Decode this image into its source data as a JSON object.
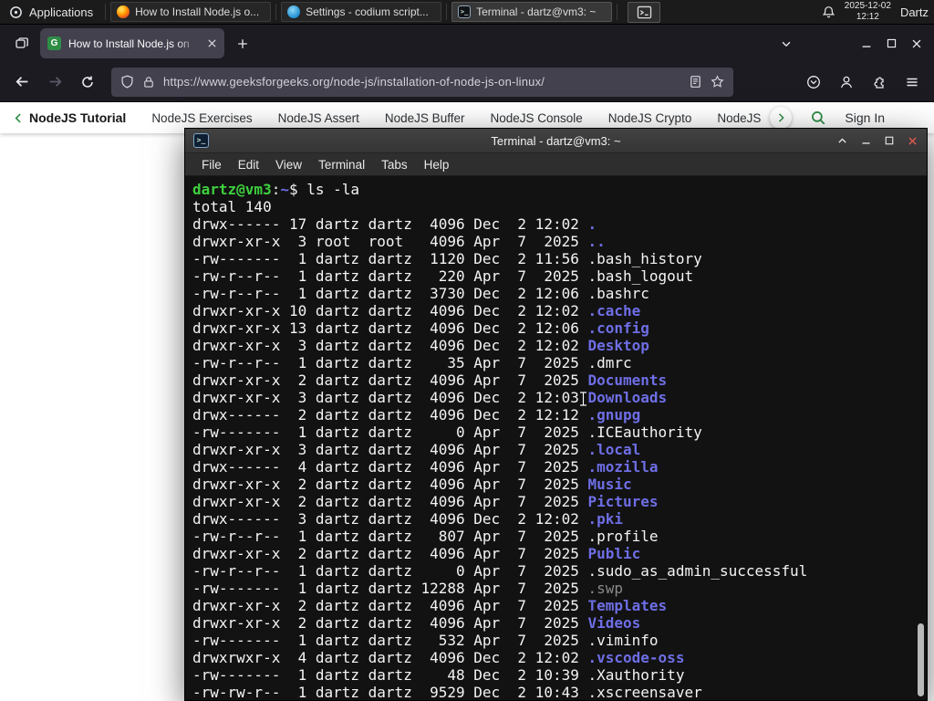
{
  "colors": {
    "accent_green": "#2f8d46",
    "terminal_dir": "#6e6ee6",
    "terminal_green": "#3ecf3e",
    "terminal_dim": "#8a8a8a"
  },
  "taskbar": {
    "applications_label": "Applications",
    "windows": [
      {
        "title": "How to Install Node.js o...",
        "icon": "firefox",
        "active": false
      },
      {
        "title": "Settings - codium script...",
        "icon": "codium",
        "active": false
      },
      {
        "title": "Terminal - dartz@vm3: ~",
        "icon": "terminal",
        "active": true
      }
    ],
    "clock_date": "2025-12-02",
    "clock_time": "12:12",
    "user_label": "Dartz"
  },
  "browser": {
    "tab_title": "How to Install Node.js on",
    "favicon_letter": "G",
    "url": "https://www.geeksforgeeks.org/node-js/installation-of-node-js-on-linux/"
  },
  "site_nav": {
    "back_item": "NodeJS Tutorial",
    "items": [
      "NodeJS Exercises",
      "NodeJS Assert",
      "NodeJS Buffer",
      "NodeJS Console",
      "NodeJS Crypto",
      "NodeJS DNS",
      "Node"
    ],
    "sign_in_label": "Sign In"
  },
  "terminal": {
    "window_title": "Terminal - dartz@vm3: ~",
    "menus": [
      "File",
      "Edit",
      "View",
      "Terminal",
      "Tabs",
      "Help"
    ],
    "prompt_user_host": "dartz@vm3",
    "prompt_colon": ":",
    "prompt_path": "~",
    "prompt_symbol": "$ ",
    "command": "ls -la",
    "total_line": "total 140",
    "listing": [
      {
        "pre": "drwx------ 17 dartz dartz  4096 Dec  2 12:02 ",
        "name": ".",
        "type": "dir"
      },
      {
        "pre": "drwxr-xr-x  3 root  root   4096 Apr  7  2025 ",
        "name": "..",
        "type": "dir"
      },
      {
        "pre": "-rw-------  1 dartz dartz  1120 Dec  2 11:56 ",
        "name": ".bash_history",
        "type": "file"
      },
      {
        "pre": "-rw-r--r--  1 dartz dartz   220 Apr  7  2025 ",
        "name": ".bash_logout",
        "type": "file"
      },
      {
        "pre": "-rw-r--r--  1 dartz dartz  3730 Dec  2 12:06 ",
        "name": ".bashrc",
        "type": "file"
      },
      {
        "pre": "drwxr-xr-x 10 dartz dartz  4096 Dec  2 12:02 ",
        "name": ".cache",
        "type": "dir"
      },
      {
        "pre": "drwxr-xr-x 13 dartz dartz  4096 Dec  2 12:06 ",
        "name": ".config",
        "type": "dir"
      },
      {
        "pre": "drwxr-xr-x  3 dartz dartz  4096 Dec  2 12:02 ",
        "name": "Desktop",
        "type": "dir"
      },
      {
        "pre": "-rw-r--r--  1 dartz dartz    35 Apr  7  2025 ",
        "name": ".dmrc",
        "type": "file"
      },
      {
        "pre": "drwxr-xr-x  2 dartz dartz  4096 Apr  7  2025 ",
        "name": "Documents",
        "type": "dir"
      },
      {
        "pre": "drwxr-xr-x  3 dartz dartz  4096 Dec  2 12:03 ",
        "name": "Downloads",
        "type": "dir"
      },
      {
        "pre": "drwx------  2 dartz dartz  4096 Dec  2 12:12 ",
        "name": ".gnupg",
        "type": "dir"
      },
      {
        "pre": "-rw-------  1 dartz dartz     0 Apr  7  2025 ",
        "name": ".ICEauthority",
        "type": "file"
      },
      {
        "pre": "drwxr-xr-x  3 dartz dartz  4096 Apr  7  2025 ",
        "name": ".local",
        "type": "dir"
      },
      {
        "pre": "drwx------  4 dartz dartz  4096 Apr  7  2025 ",
        "name": ".mozilla",
        "type": "dir"
      },
      {
        "pre": "drwxr-xr-x  2 dartz dartz  4096 Apr  7  2025 ",
        "name": "Music",
        "type": "dir"
      },
      {
        "pre": "drwxr-xr-x  2 dartz dartz  4096 Apr  7  2025 ",
        "name": "Pictures",
        "type": "dir"
      },
      {
        "pre": "drwx------  3 dartz dartz  4096 Dec  2 12:02 ",
        "name": ".pki",
        "type": "dir"
      },
      {
        "pre": "-rw-r--r--  1 dartz dartz   807 Apr  7  2025 ",
        "name": ".profile",
        "type": "file"
      },
      {
        "pre": "drwxr-xr-x  2 dartz dartz  4096 Apr  7  2025 ",
        "name": "Public",
        "type": "dir"
      },
      {
        "pre": "-rw-r--r--  1 dartz dartz     0 Apr  7  2025 ",
        "name": ".sudo_as_admin_successful",
        "type": "file"
      },
      {
        "pre": "-rw-------  1 dartz dartz 12288 Apr  7  2025 ",
        "name": ".swp",
        "type": "dim"
      },
      {
        "pre": "drwxr-xr-x  2 dartz dartz  4096 Apr  7  2025 ",
        "name": "Templates",
        "type": "dir"
      },
      {
        "pre": "drwxr-xr-x  2 dartz dartz  4096 Apr  7  2025 ",
        "name": "Videos",
        "type": "dir"
      },
      {
        "pre": "-rw-------  1 dartz dartz   532 Apr  7  2025 ",
        "name": ".viminfo",
        "type": "file"
      },
      {
        "pre": "drwxrwxr-x  4 dartz dartz  4096 Dec  2 12:02 ",
        "name": ".vscode-oss",
        "type": "dir"
      },
      {
        "pre": "-rw-------  1 dartz dartz    48 Dec  2 10:39 ",
        "name": ".Xauthority",
        "type": "file"
      },
      {
        "pre": "-rw-rw-r--  1 dartz dartz  9529 Dec  2 10:43 ",
        "name": ".xscreensaver",
        "type": "file"
      }
    ]
  }
}
